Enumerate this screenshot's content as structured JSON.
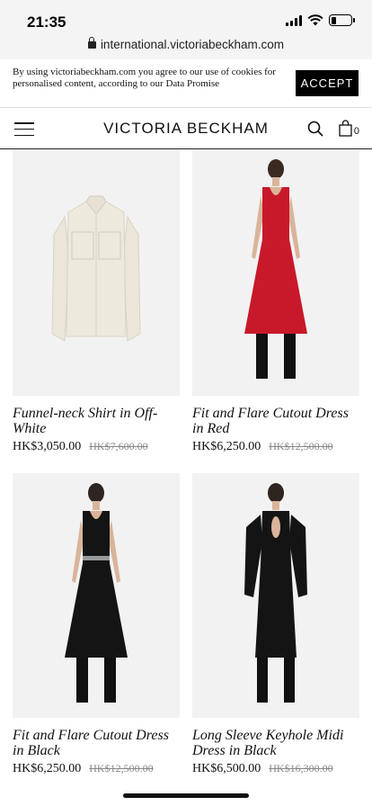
{
  "status_bar": {
    "time": "21:35"
  },
  "browser": {
    "url": "international.victoriabeckham.com"
  },
  "cookie_banner": {
    "text": "By using victoriabeckham.com you agree to our use of cookies for personalised content, according to our Data Promise",
    "accept_label": "ACCEPT"
  },
  "header": {
    "logo": "VICTORIA BECKHAM",
    "bag_count": "0"
  },
  "products": [
    {
      "title": "Funnel-neck Shirt in Off-White",
      "price": "HK$3,050.00",
      "old_price": "HK$7,600.00",
      "image": "off-white shirt"
    },
    {
      "title": "Fit and Flare Cutout Dress in Red",
      "price": "HK$6,250.00",
      "old_price": "HK$12,500.00",
      "image": "model in red dress"
    },
    {
      "title": "Fit and Flare Cutout Dress in Black",
      "price": "HK$6,250.00",
      "old_price": "HK$12,500.00",
      "image": "model in black dress"
    },
    {
      "title": "Long Sleeve Keyhole Midi Dress in Black",
      "price": "HK$6,500.00",
      "old_price": "HK$16,300.00",
      "image": "model in black long sleeve dress"
    }
  ],
  "colors": {
    "accept_bg": "#000000",
    "red_dress": "#c8192a",
    "image_bg": "#f2f2f2"
  }
}
